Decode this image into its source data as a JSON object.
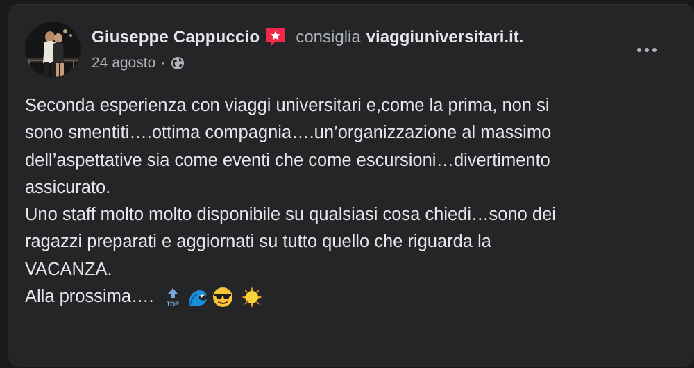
{
  "post": {
    "author": "Giuseppe Cappuccio",
    "recommend_icon": "recommend-badge-icon",
    "recommend_text": "consiglia",
    "page_name": "viaggiuniversitari.it.",
    "date": "24 agosto",
    "separator": "·",
    "privacy_icon": "globe-icon",
    "more_icon": "more-options-icon",
    "body_lines": [
      "Seconda esperienza con viaggi universitari e,come la prima, non si",
      "sono smentiti….ottima compagnia….un’organizzazione al massimo",
      "dell’aspettative sia come eventi che come escursioni…divertimento",
      "assicurato.",
      "Uno staff molto molto disponibile su qualsiasi cosa chiedi…sono dei",
      "ragazzi preparati e aggiornati su tutto quello che riguarda la",
      "VACANZA."
    ],
    "closing_text": "Alla prossima….",
    "closing_emojis": [
      "top-arrow-emoji",
      "wave-emoji",
      "sunglasses-emoji",
      "sun-emoji"
    ],
    "colors": {
      "background": "#18191a",
      "card": "#242526",
      "primary_text": "#e4e6eb",
      "secondary_text": "#b0b3b8",
      "badge": "#f02849"
    }
  }
}
